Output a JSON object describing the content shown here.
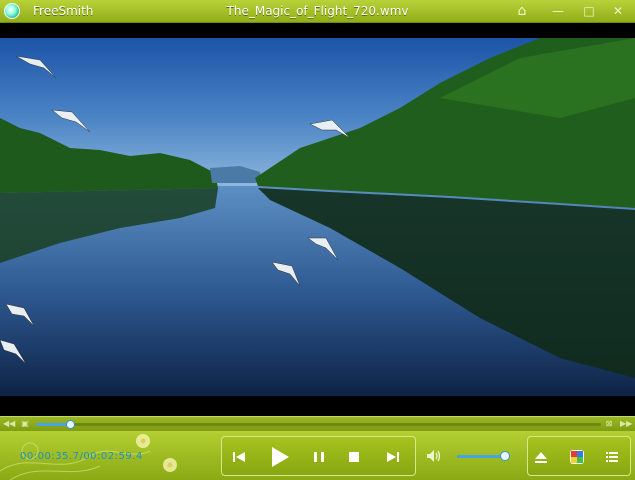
{
  "window": {
    "app_name": "FreeSmith",
    "title": "The_Magic_of_Flight_720.wmv"
  },
  "title_buttons": {
    "home": "⌂",
    "minimize": "—",
    "maximize": "□",
    "close": "✕"
  },
  "player": {
    "time_display": "00:00:35.7/00:02:59.4",
    "seek_progress": 0.06,
    "volume_level": 0.92
  },
  "icons": {
    "prev": "skip-back-icon",
    "play": "play-icon",
    "pause": "pause-icon",
    "stop": "stop-icon",
    "next": "skip-forward-icon",
    "volume": "speaker-icon",
    "eject": "eject-icon",
    "color": "color-palette-icon",
    "playlist": "playlist-icon"
  },
  "colors": {
    "accent": "#4aa3e0",
    "bar": "#9ab823",
    "time_text": "#1f90c8"
  }
}
